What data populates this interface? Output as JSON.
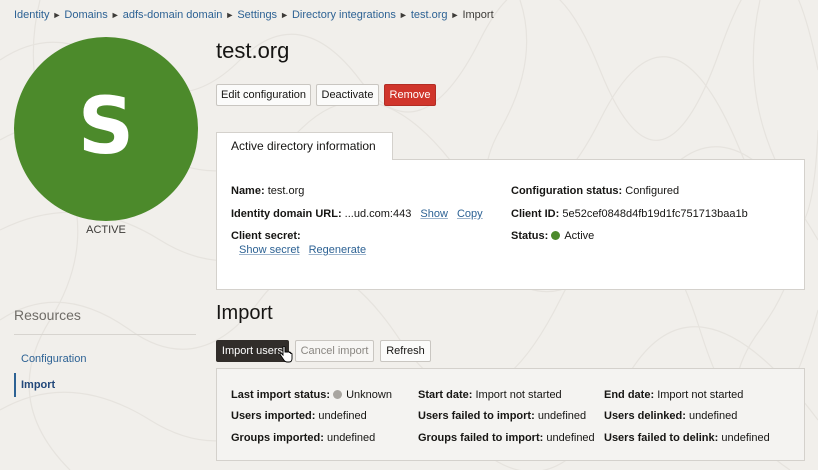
{
  "breadcrumb": [
    "Identity",
    "Domains",
    "adfs-domain domain",
    "Settings",
    "Directory integrations",
    "test.org",
    "Import"
  ],
  "avatar": {
    "letter": "S",
    "status": "ACTIVE",
    "color": "#4c8a2b"
  },
  "title": "test.org",
  "actions": {
    "edit": "Edit configuration",
    "deactivate": "Deactivate",
    "remove": "Remove"
  },
  "tab": {
    "label": "Active directory information"
  },
  "info": {
    "name_label": "Name:",
    "name_value": "test.org",
    "url_label": "Identity domain URL:",
    "url_value": "...ud.com:443",
    "url_show": "Show",
    "url_copy": "Copy",
    "secret_label": "Client secret:",
    "secret_show": "Show secret",
    "secret_regen": "Regenerate",
    "config_status_label": "Configuration status:",
    "config_status_value": "Configured",
    "client_id_label": "Client ID:",
    "client_id_value": "5e52cef0848d4fb19d1fc751713baa1b",
    "status_label": "Status:",
    "status_value": "Active"
  },
  "resources": {
    "title": "Resources",
    "items": [
      "Configuration",
      "Import"
    ],
    "active": "Import"
  },
  "import": {
    "title": "Import",
    "buttons": {
      "import_users": "Import users",
      "cancel_import": "Cancel import",
      "refresh": "Refresh"
    },
    "last_status_label": "Last import status:",
    "last_status_value": "Unknown",
    "start_label": "Start date:",
    "start_value": "Import not started",
    "end_label": "End date:",
    "end_value": "Import not started",
    "users_imported_label": "Users imported:",
    "users_imported_value": "undefined",
    "users_failed_label": "Users failed to import:",
    "users_failed_value": "undefined",
    "users_delinked_label": "Users delinked:",
    "users_delinked_value": "undefined",
    "groups_imported_label": "Groups imported:",
    "groups_imported_value": "undefined",
    "groups_failed_label": "Groups failed to import:",
    "groups_failed_value": "undefined",
    "delink_failed_label": "Users failed to delink:",
    "delink_failed_value": "undefined"
  }
}
